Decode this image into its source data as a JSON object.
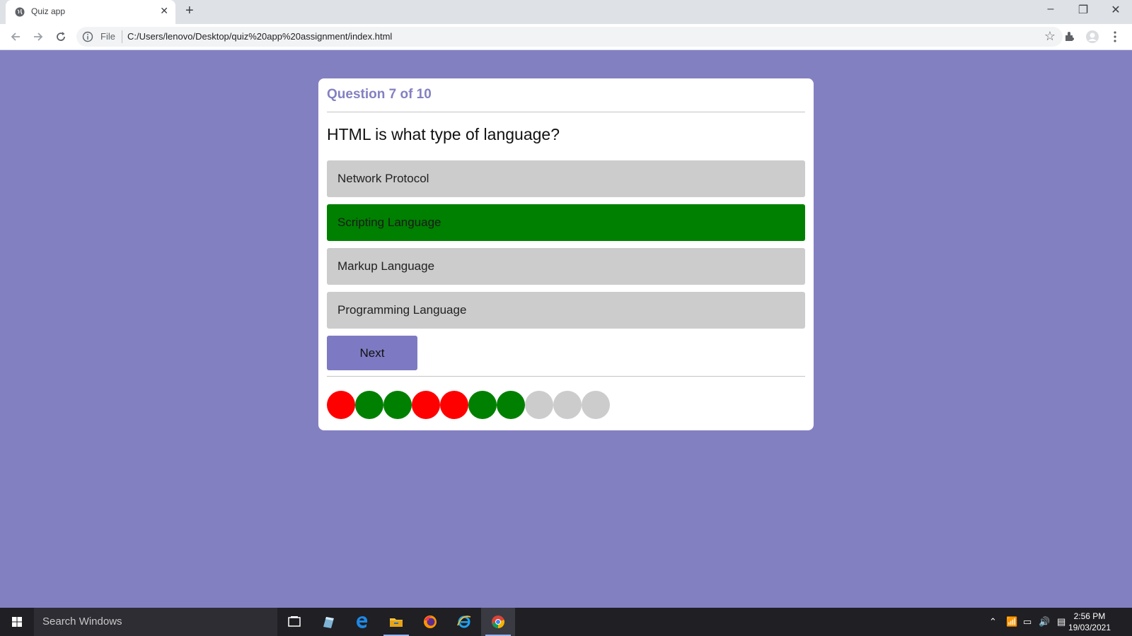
{
  "browser": {
    "tab_title": "Quiz app",
    "new_tab": "+",
    "close_tab": "✕",
    "omnibox_file": "File",
    "url": "C:/Users/lenovo/Desktop/quiz%20app%20assignment/index.html"
  },
  "quiz": {
    "progress_label": "Question 7 of 10",
    "question": "HTML is what type of language?",
    "options": [
      {
        "label": "Network Protocol",
        "state": "default"
      },
      {
        "label": "Scripting Language",
        "state": "correct"
      },
      {
        "label": "Markup Language",
        "state": "default"
      },
      {
        "label": "Programming Language",
        "state": "default"
      }
    ],
    "next_label": "Next",
    "results": [
      "wrong",
      "right",
      "right",
      "wrong",
      "wrong",
      "right",
      "right",
      "pending",
      "pending",
      "pending"
    ],
    "colors": {
      "wrong": "#ff0000",
      "right": "#008000",
      "pending": "#cccccc",
      "accent": "#8380c2",
      "background": "#8380c2"
    }
  },
  "taskbar": {
    "search_placeholder": "Search Windows",
    "time": "2:56 PM",
    "date": "19/03/2021",
    "pinned_icons": [
      "task-view-icon",
      "paint-icon",
      "edge-icon",
      "file-explorer-icon",
      "firefox-icon",
      "internet-explorer-icon",
      "chrome-icon"
    ]
  }
}
